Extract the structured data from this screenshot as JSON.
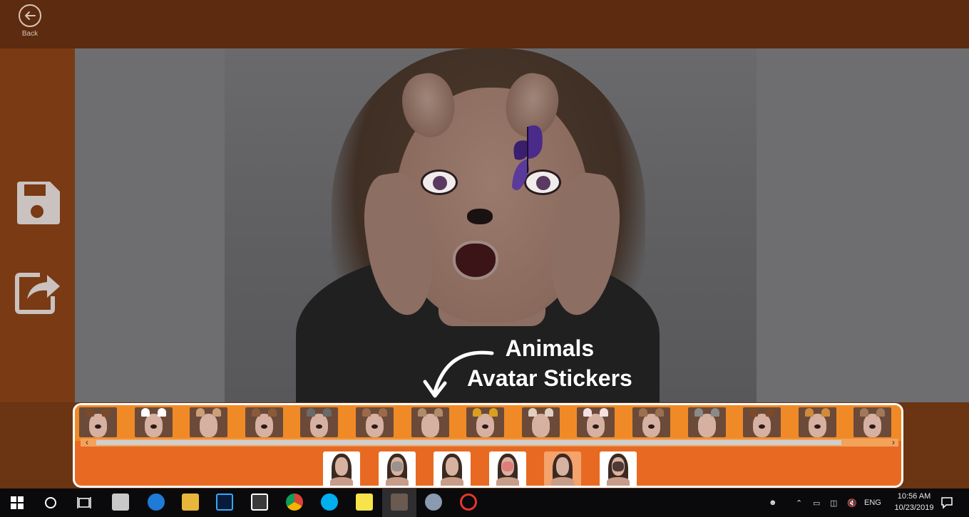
{
  "topbar": {
    "back_label": "Back"
  },
  "sidebar": {
    "save_icon": "save-icon",
    "share_icon": "share-icon"
  },
  "callout": {
    "line1": "Animals",
    "line2": "Avatar Stickers"
  },
  "sticker_strip": {
    "items": [
      {
        "name": "sticker-1",
        "ear": "#7a4a2a",
        "nose": true
      },
      {
        "name": "sticker-2",
        "ear": "#ffffff",
        "nose": true
      },
      {
        "name": "sticker-3",
        "ear": "#caa07a",
        "nose": false
      },
      {
        "name": "sticker-4",
        "ear": "#8a5a3a",
        "nose": true
      },
      {
        "name": "sticker-5",
        "ear": "#6a6a6a",
        "nose": true
      },
      {
        "name": "sticker-6",
        "ear": "#9a6a4a",
        "nose": true
      },
      {
        "name": "sticker-7",
        "ear": "#b08a6a",
        "nose": false
      },
      {
        "name": "sticker-8",
        "ear": "#d9a020",
        "nose": true
      },
      {
        "name": "sticker-9",
        "ear": "#e0d0c0",
        "nose": false
      },
      {
        "name": "sticker-10",
        "ear": "#f5e0e0",
        "nose": true
      },
      {
        "name": "sticker-11",
        "ear": "#9a7050",
        "nose": true
      },
      {
        "name": "sticker-12",
        "ear": "#8a8a8a",
        "nose": false
      },
      {
        "name": "sticker-13",
        "ear": "#7a4a2a",
        "nose": true
      },
      {
        "name": "sticker-14",
        "ear": "#d08a3a",
        "nose": true
      },
      {
        "name": "sticker-15",
        "ear": "#a0785a",
        "nose": true
      }
    ]
  },
  "categories": {
    "selected_index": 4,
    "items": [
      {
        "name": "category-1",
        "mark": ""
      },
      {
        "name": "category-2",
        "mark": "#8a8a8a"
      },
      {
        "name": "category-3",
        "mark": ""
      },
      {
        "name": "category-4",
        "mark": "#e07070"
      },
      {
        "name": "category-5",
        "mark": ""
      },
      {
        "name": "category-6",
        "mark": "#2a1a1a"
      }
    ]
  },
  "taskbar": {
    "apps": [
      "windows-start-icon",
      "cortana-icon",
      "task-view-icon",
      "mail-icon",
      "edge-icon",
      "file-explorer-icon",
      "photoshop-icon",
      "store-icon",
      "chrome-icon",
      "skype-icon",
      "sticky-notes-icon",
      "photo-app-icon",
      "paint-icon",
      "app-icon"
    ],
    "language": "ENG",
    "time": "10:56 AM",
    "date": "10/23/2019"
  }
}
